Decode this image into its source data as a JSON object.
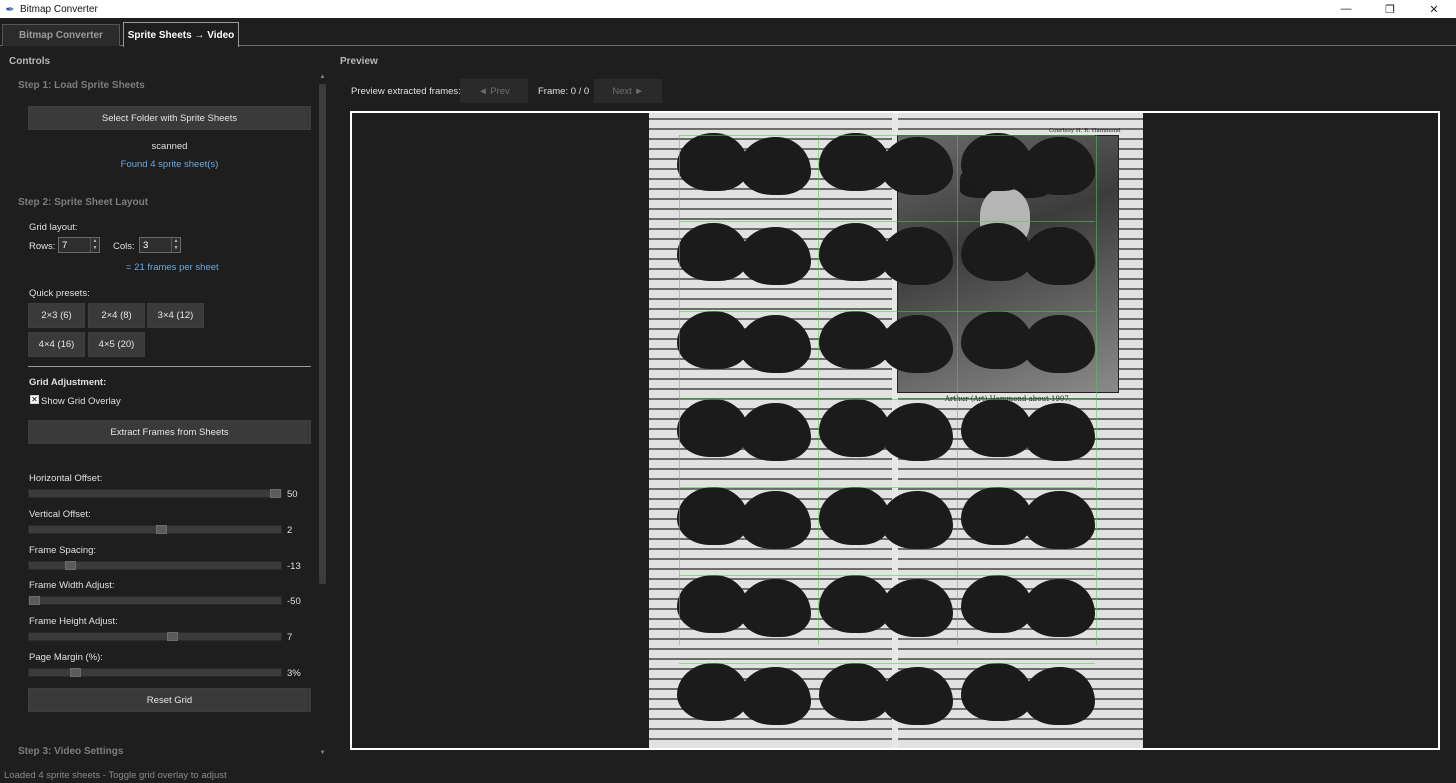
{
  "window": {
    "title": "Bitmap Converter",
    "minimize_glyph": "—",
    "maximize_glyph": "❐",
    "close_glyph": "✕"
  },
  "tabs": [
    {
      "label": "Bitmap Converter",
      "active": false
    },
    {
      "label": "Sprite Sheets → Video",
      "active": true
    }
  ],
  "controls": {
    "title": "Controls",
    "step1": {
      "label": "Step 1: Load Sprite Sheets",
      "select_button": "Select Folder with Sprite Sheets",
      "folder_name": "scanned",
      "found_text": "Found 4 sprite sheet(s)"
    },
    "step2": {
      "label": "Step 2: Sprite Sheet Layout",
      "grid_layout_label": "Grid layout:",
      "rows_label": "Rows:",
      "rows_value": "7",
      "cols_label": "Cols:",
      "cols_value": "3",
      "frames_per_sheet": "= 21 frames per sheet",
      "quick_presets_label": "Quick presets:",
      "presets": [
        "2×3 (6)",
        "2×4 (8)",
        "3×4 (12)",
        "4×4 (16)",
        "4×5 (20)"
      ],
      "grid_adjustment_label": "Grid Adjustment:",
      "show_grid_overlay": "Show Grid Overlay",
      "show_grid_checked": true,
      "extract_button": "Extract Frames from Sheets",
      "sliders": [
        {
          "label": "Horizontal Offset:",
          "value": "50",
          "fraction": 0.99
        },
        {
          "label": "Vertical Offset:",
          "value": "2",
          "fraction": 0.51
        },
        {
          "label": "Frame Spacing:",
          "value": "-13",
          "fraction": 0.15
        },
        {
          "label": "Frame Width Adjust:",
          "value": "-50",
          "fraction": 0.0
        },
        {
          "label": "Frame Height Adjust:",
          "value": "7",
          "fraction": 0.55
        },
        {
          "label": "Page Margin (%):",
          "value": "3%",
          "fraction": 0.16
        }
      ],
      "reset_button": "Reset Grid"
    },
    "step3": {
      "label": "Step 3: Video Settings"
    }
  },
  "preview": {
    "title": "Preview",
    "extracted_label": "Preview extracted frames:",
    "prev_button": "◄ Prev",
    "frame_counter": "Frame: 0 / 0",
    "next_button": "Next ►",
    "courtesy_text": "Courtesy H. R. Hammond",
    "photo_caption": "Arthur (Art) Hammond about 1907."
  },
  "status": {
    "text": "Loaded 4 sprite sheets - Toggle grid overlay to adjust"
  },
  "colors": {
    "background": "#1e1e1e",
    "button": "#3a3a3a",
    "info_blue": "#6ea8e0",
    "grid_overlay": "#4ec94e"
  }
}
